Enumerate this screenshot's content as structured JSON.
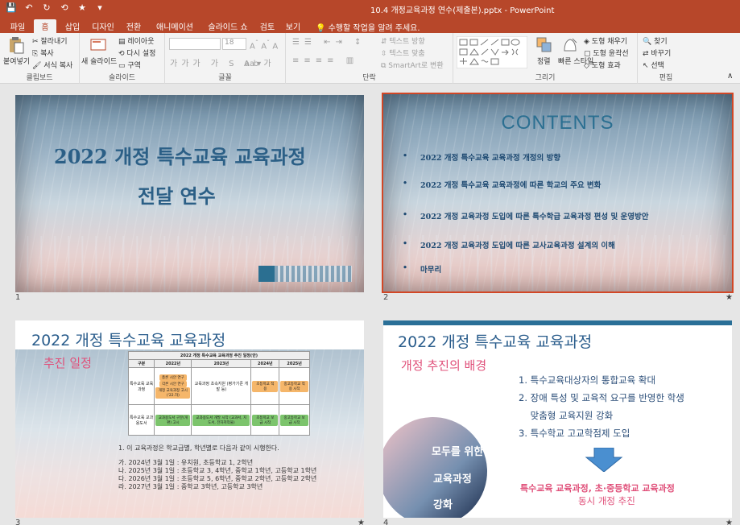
{
  "titlebar": {
    "title": "10.4 개정교육과정 연수(제출본).pptx - PowerPoint",
    "qat": [
      "💾",
      "↶",
      "↻",
      "⟲",
      "★",
      "▾"
    ]
  },
  "tabs": [
    {
      "label": "파일",
      "active": false
    },
    {
      "label": "홈",
      "active": true
    },
    {
      "label": "삽입",
      "active": false
    },
    {
      "label": "디자인",
      "active": false
    },
    {
      "label": "전환",
      "active": false
    },
    {
      "label": "애니메이션",
      "active": false
    },
    {
      "label": "슬라이드 쇼",
      "active": false
    },
    {
      "label": "검토",
      "active": false
    },
    {
      "label": "보기",
      "active": false
    }
  ],
  "tellme": "수행할 작업을 알려 주세요.",
  "ribbon": {
    "clipboard": {
      "paste": "붙여넣기",
      "cut": "잘라내기",
      "copy": "복사",
      "format_painter": "서식 복사",
      "label": "클립보드"
    },
    "slides": {
      "new_slide": "새 슬라이드",
      "layout": "레이아웃",
      "reset": "다시 설정",
      "section": "구역",
      "label": "슬라이드"
    },
    "font": {
      "font_name": "",
      "font_size": "18",
      "label": "글꼴"
    },
    "paragraph": {
      "text_direction": "텍스트 방향",
      "align_text": "텍스트 맞춤",
      "smartart": "SmartArt로 변환",
      "label": "단락"
    },
    "drawing": {
      "arrange": "정렬",
      "quick_styles": "빠른 스타일",
      "fill": "도형 채우기",
      "outline": "도형 윤곽선",
      "effects": "도형 효과",
      "label": "그리기"
    },
    "editing": {
      "find": "찾기",
      "replace": "바꾸기",
      "select": "선택",
      "label": "편집"
    }
  },
  "slides": [
    {
      "number": "1",
      "title_line1": "2022 개정 특수교육 교육과정",
      "title_line2": "전달 연수"
    },
    {
      "number": "2",
      "heading": "CONTENTS",
      "items": [
        "2022 개정 특수교육 교육과정 개정의 방향",
        "2022 개정 특수교육 교육과정에 따른 학교의 주요 변화",
        "2022 개정 교육과정 도입에 따른 특수학급 교육과정 편성 및 운영방안",
        "2022 개정 교육과정 도입에 따른 교사교육과정 설계의 이해",
        "마무리"
      ]
    },
    {
      "number": "3",
      "title": "2022 개정 특수교육 교육과정",
      "subtitle": "추진 일정",
      "table_caption": "2022 개정 특수교육 교육과정 추진 일정(안)",
      "table_header": [
        "구분",
        "2022년",
        "2023년",
        "2024년",
        "2025년"
      ],
      "row1_label": "특수교육 교육과정",
      "row2_label": "특수교육 교과용도서",
      "cells": {
        "r1_2022a": "총론 시안 연구",
        "r1_2022b": "각론 시안 연구",
        "r1_2022c": "개정 교육과정 고시('22.하)",
        "r1_2023": "교육과정 초속지원 (평가기준 개발 등)",
        "r1_2024": "초등학교 적용",
        "r1_2025": "중고등학교 적용 시작",
        "r2_2022": "교과용도서 구분(개편) 고시",
        "r2_2023": "교과용도서 개발 시작 (교과서, 지도서, 전자저작물)",
        "r2_2024": "초등학교 보급 시작",
        "r2_2025": "중고등학교 보급 시작"
      },
      "notes": [
        "1.  이 교육과정은 학교급별, 학년별로 다음과 같이 시행한다.",
        "",
        "가. 2024년 3월 1일 : 유치원, 초등학교 1, 2학년",
        "나. 2025년 3월 1일 : 초등학교 3, 4학년, 중학교 1학년, 고등학교 1학년",
        "다. 2026년 3월 1일 : 초등학교 5, 6학년, 중학교 2학년, 고등학교 2학년",
        "라. 2027년 3월 1일 : 중학교 3학년, 고등학교 3학년"
      ]
    },
    {
      "number": "4",
      "title": "2022 개정 특수교육 교육과정",
      "subtitle": "개정 추진의 배경",
      "list": [
        "1. 특수교육대상자의 통합교육 확대",
        "2. 장애 특성 및 교육적 요구를 반영한 학생",
        "    맞춤형 교육지원 강화",
        "3. 특수학교 고교학점제 도입"
      ],
      "foot1": "특수교육 교육과정, 초·중등학교 교육과정",
      "foot2": "동시 개정 추진",
      "pill_lines": [
        "모두를 위한",
        "교육과정",
        "강화"
      ]
    }
  ],
  "colors": {
    "accent": "#b7472a",
    "selected_outline": "#d24726",
    "title_blue": "#2a5d8c",
    "pink": "#e0507a"
  }
}
